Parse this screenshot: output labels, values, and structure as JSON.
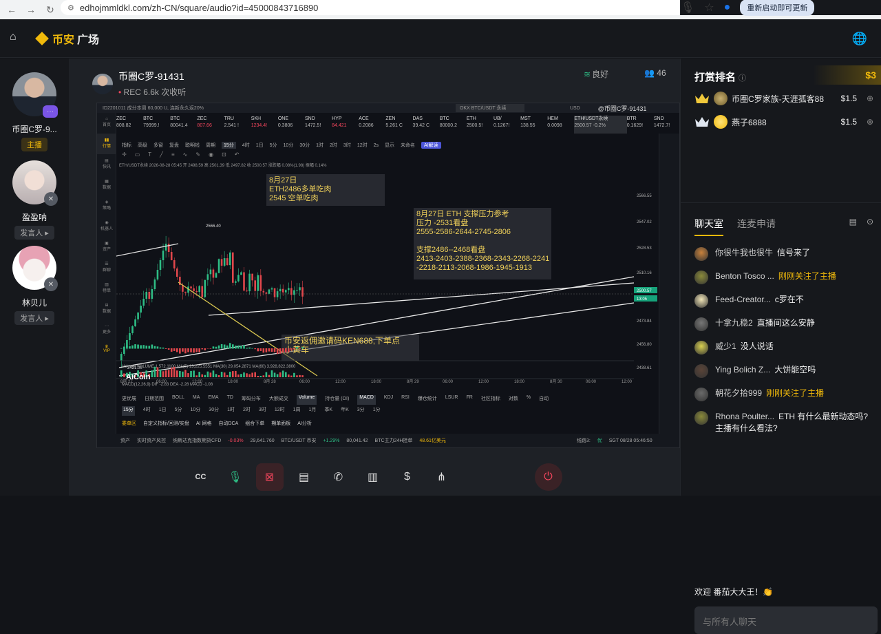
{
  "browser": {
    "url": "edhojmmldkl.com/zh-CN/square/audio?id=45000843716890",
    "restart_label": "重新启动即可更新"
  },
  "header": {
    "brand": "币安",
    "section": "广场"
  },
  "speakers": [
    {
      "name": "币圈C罗-9...",
      "role": "主播",
      "badge": "···"
    },
    {
      "name": "盈盈呐",
      "role": "发言人 ▸"
    },
    {
      "name": "林贝儿",
      "role": "发言人 ▸"
    }
  ],
  "room": {
    "host_name": "币圈C罗-91431",
    "rec_label": "REC",
    "listens": "6.6k 次收听",
    "signal": "良好",
    "listeners": "46"
  },
  "screen": {
    "topbar": "ID2201011   成分本周 60,000 U, 连新永久返20%",
    "search": "OKX BTC/USDT 永续",
    "currency": "USD",
    "watermark": "@币圈C罗-91431",
    "tickers": [
      {
        "sym": "ZEC",
        "val": "808.82"
      },
      {
        "sym": "BTC",
        "val": "79999.!"
      },
      {
        "sym": "BTC",
        "val": "80041.4"
      },
      {
        "sym": "ZEC",
        "val": "807.66",
        "dn": true
      },
      {
        "sym": "TRU",
        "val": "2.541 !"
      },
      {
        "sym": "SKH",
        "val": "1234.4!",
        "dn": true
      },
      {
        "sym": "ONE",
        "val": "0.3806"
      },
      {
        "sym": "SND",
        "val": "1472.5!"
      },
      {
        "sym": "HYP",
        "val": "84.421",
        "dn": true
      },
      {
        "sym": "ACE",
        "val": "0.2086"
      },
      {
        "sym": "ZEN",
        "val": "5.261 C"
      },
      {
        "sym": "DAS",
        "val": "39.42 C"
      },
      {
        "sym": "BTC",
        "val": "80000.2"
      },
      {
        "sym": "ETH",
        "val": "2500.5!"
      },
      {
        "sym": "UB/",
        "val": "0.1267!"
      },
      {
        "sym": "MST",
        "val": "138.55"
      },
      {
        "sym": "HEM",
        "val": "0.0098"
      },
      {
        "sym": "ETH/USDT永续",
        "val": "2500.57 -0.2%"
      },
      {
        "sym": "BTR",
        "val": "0.1629!"
      },
      {
        "sym": "SND",
        "val": "1472.7!"
      }
    ],
    "toolrow": [
      "指标",
      "高级",
      "多窗",
      "复盘",
      "聪明钱",
      "周期",
      "15分",
      "4时",
      "1日",
      "5分",
      "10分",
      "30分",
      "1时",
      "2时",
      "3时",
      "12时",
      "2s",
      "显示",
      "未命名",
      "AI解读"
    ],
    "chart_header": "ETH/USDT永续  2026-08-28 05:45  开 2498.59 高 2501.39 低 2497.82 收 2500.57 涨跌幅 0.08%(1.98) 振幅 0.14%",
    "high_label": "2566.40",
    "low_label": "2421.00",
    "annotations": {
      "a1": "8月27日\nETH2486多单吃肉\n2545 空单吃肉",
      "a2": "8月27日 ETH 支撑压力参考\n压力 -2531看盘\n2555-2586-2644-2745-2806\n\n支撑2486--2468看盘\n2413-2403-2388-2368-2343-2268-2241\n-2218-2113-2068-1986-1945-1913",
      "a3": "币安返佣邀请码KEN688,下单点\n小黄车"
    },
    "price_ticks": [
      "2566.55",
      "2547.02",
      "2528.53",
      "2510.16",
      "2500.57",
      "13:05",
      "2473.84",
      "2456.80",
      "2438.61"
    ],
    "macd_label": "MACD(12,26,9)  DIF -2.83  DEA -2.28  MACD -1.08",
    "volume_label": "Volume  VOLUME 1,572.1100   MA(5) 13,225.5551   MA(30) 29,054.2871   MA(60) 3,928,822.3800",
    "x_ticks": [
      "8月 27",
      "06:00",
      "12:00",
      "18:00",
      "8月 28",
      "06:00",
      "12:00",
      "18:00",
      "8月 29",
      "06:00",
      "12:00",
      "18:00",
      "8月 30",
      "06:00",
      "12:00"
    ],
    "brand": "AiCoin",
    "bottom_tabs": [
      "更优展",
      "日期范围",
      "BOLL",
      "MA",
      "EMA",
      "TD",
      "筹码分布",
      "大额成交",
      "Volume",
      "持仓量 (OI)",
      "MACD",
      "KDJ",
      "RSI",
      "爆仓统计",
      "LSUR",
      "FR",
      "社区指标",
      "对数",
      "%",
      "自动"
    ],
    "tf_row": [
      "15分",
      "4时",
      "1日",
      "5分",
      "10分",
      "30分",
      "1时",
      "2时",
      "3时",
      "12时",
      "1周",
      "1月",
      "季K",
      "年K",
      "3分",
      "1分"
    ],
    "bot_menu": [
      "委单区",
      "自定义指标/回测/实盘",
      "AI 网格",
      "自动DCA",
      "组合下单",
      "期单面板",
      "AI分析"
    ],
    "status": {
      "s1": "资产",
      "s2": "实时资产风控",
      "s3": "纳斯达克指数期货CFD",
      "s4": "-0.03%",
      "s5": "29,641.760",
      "s6": "BTC/USDT 币安",
      "s7": "+1.29%",
      "s8": "80,041.42",
      "s9": "BTC主力24H挂单",
      "s10": "48.61亿美元",
      "s11": "线路3:",
      "s12": "优",
      "s13": "SGT 08/28 05:46:50"
    }
  },
  "controls": [
    "CC",
    "mic",
    "close",
    "calendar",
    "call",
    "chart",
    "dollar",
    "share",
    "power"
  ],
  "ranking": {
    "title": "打赏排名",
    "top_amount": "$3",
    "rows": [
      {
        "name": "币圈C罗家族-天涯孤客88",
        "amount": "$1.5"
      },
      {
        "name": "燕子6888",
        "amount": "$1.5"
      }
    ]
  },
  "chat": {
    "tab_active": "聊天室",
    "tab_inactive": "连麦申请",
    "messages": [
      {
        "user": "你很牛我也很牛",
        "text": "信号来了",
        "follow": false
      },
      {
        "user": "Benton Tosco ...",
        "text": "刚刚关注了主播",
        "follow": true
      },
      {
        "user": "Feed-Creator...",
        "text": "c罗在不",
        "follow": false
      },
      {
        "user": "十拿九稳2",
        "text": "直播间这么安静",
        "follow": false
      },
      {
        "user": "威少1",
        "text": "没人说话",
        "follow": false
      },
      {
        "user": "Ying Bolich Z...",
        "text": "大饼能空吗",
        "follow": false
      },
      {
        "user": "朝花夕拾999",
        "text": "刚刚关注了主播",
        "follow": true
      },
      {
        "user": "Rhona Poulter...",
        "text": "ETH 有什么最新动态吗? 主播有什么看法?",
        "follow": false
      }
    ],
    "welcome": "欢迎 番茄大大王！👏",
    "input_placeholder": "与所有人聊天"
  }
}
